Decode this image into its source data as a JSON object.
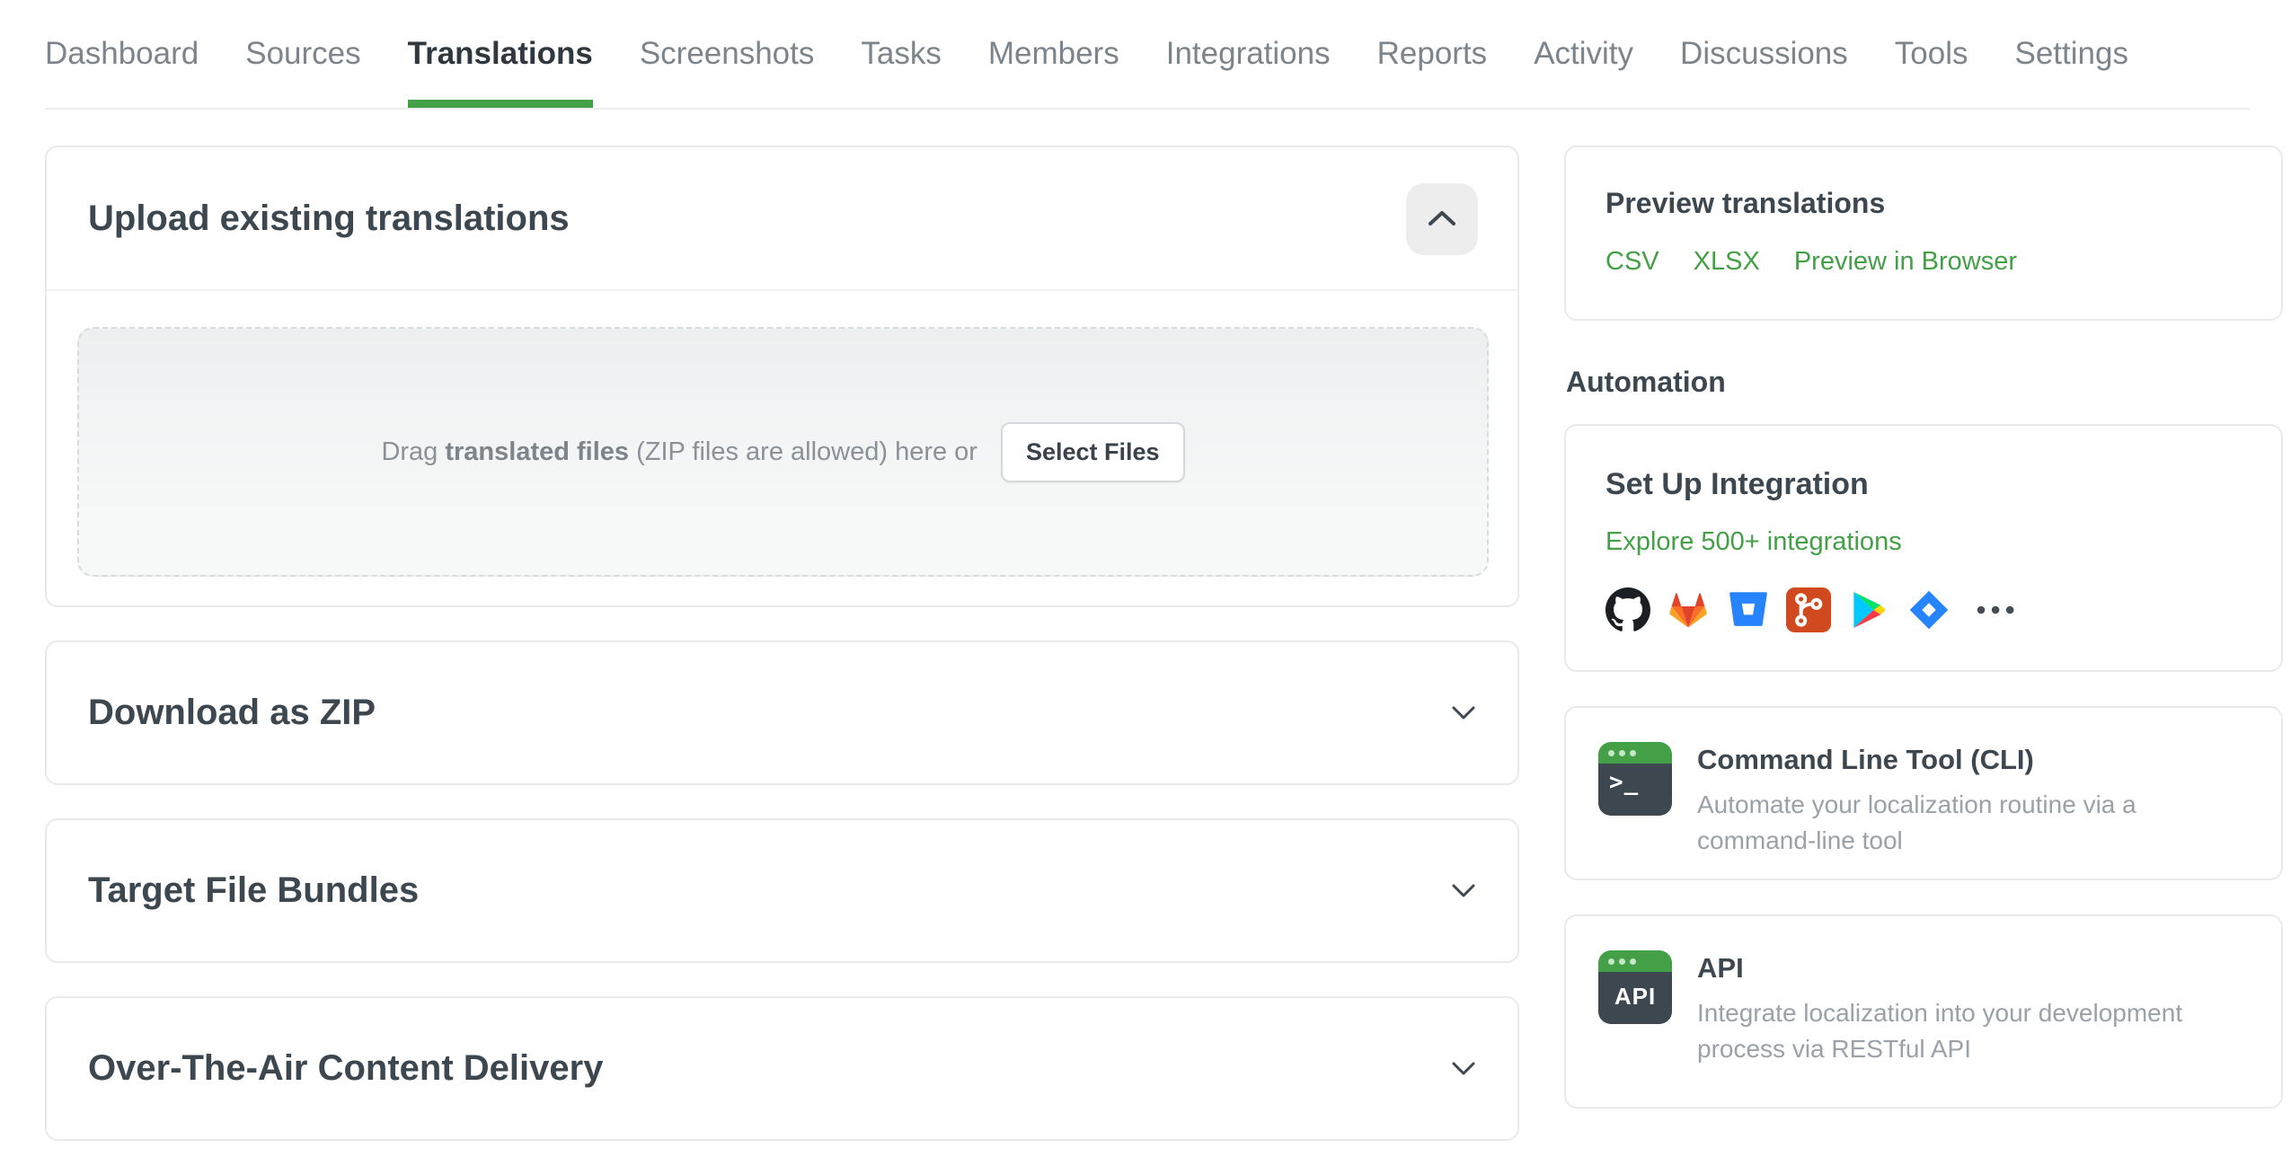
{
  "nav": {
    "items": [
      {
        "label": "Dashboard"
      },
      {
        "label": "Sources"
      },
      {
        "label": "Translations",
        "active": true
      },
      {
        "label": "Screenshots"
      },
      {
        "label": "Tasks"
      },
      {
        "label": "Members"
      },
      {
        "label": "Integrations"
      },
      {
        "label": "Reports"
      },
      {
        "label": "Activity"
      },
      {
        "label": "Discussions"
      },
      {
        "label": "Tools"
      },
      {
        "label": "Settings"
      }
    ]
  },
  "upload": {
    "title": "Upload existing translations",
    "collapse_icon": "chevron-up-icon",
    "dropzone": {
      "text_before_bold": "Drag ",
      "text_bold": "translated files",
      "text_after_bold": " (ZIP files are allowed) here or",
      "button_label": "Select Files"
    }
  },
  "sections": {
    "download_zip": "Download as ZIP",
    "target_bundles": "Target File Bundles",
    "ota": "Over-The-Air Content Delivery"
  },
  "sidebar": {
    "preview": {
      "title": "Preview translations",
      "links": [
        {
          "label": "CSV"
        },
        {
          "label": "XLSX"
        },
        {
          "label": "Preview in Browser"
        }
      ]
    },
    "automation_heading": "Automation",
    "integration": {
      "title": "Set Up Integration",
      "link": "Explore 500+ integrations",
      "icons": [
        "github",
        "gitlab",
        "bitbucket",
        "git",
        "google-play",
        "jira",
        "more"
      ]
    },
    "cli": {
      "title": "Command Line Tool (CLI)",
      "description": "Automate your localization routine via a\ncommand-line tool",
      "icon_label": ">_"
    },
    "api": {
      "title": "API",
      "description": "Integrate localization into your development\nprocess via RESTful API",
      "icon_label": "API"
    }
  },
  "colors": {
    "accent_green": "#43a047",
    "title_text": "#3d4750",
    "nav_inactive": "#7c848c",
    "muted_text": "#9aa1a8",
    "card_border": "#e8eaec"
  }
}
